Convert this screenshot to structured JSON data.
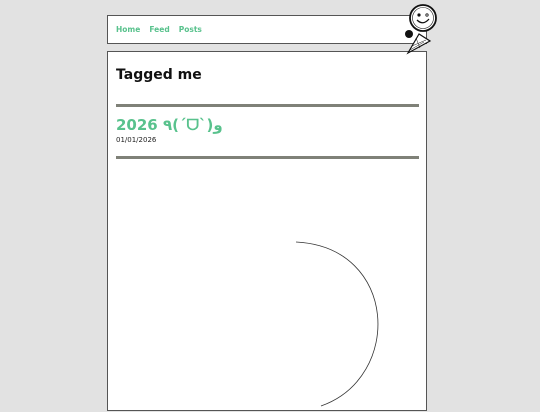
{
  "nav": {
    "items": [
      {
        "label": "Home"
      },
      {
        "label": "Feed"
      },
      {
        "label": "Posts"
      }
    ]
  },
  "page": {
    "title": "Tagged me"
  },
  "entries": [
    {
      "title": "2026 ٩(ˊᗜˋ)و",
      "date": "01/01/2026"
    }
  ],
  "colors": {
    "accent": "#59c28d",
    "rule": "#7f8178",
    "background": "#e2e2e2"
  },
  "icons": {
    "avatar": "smiley-ice-cream-icon"
  }
}
